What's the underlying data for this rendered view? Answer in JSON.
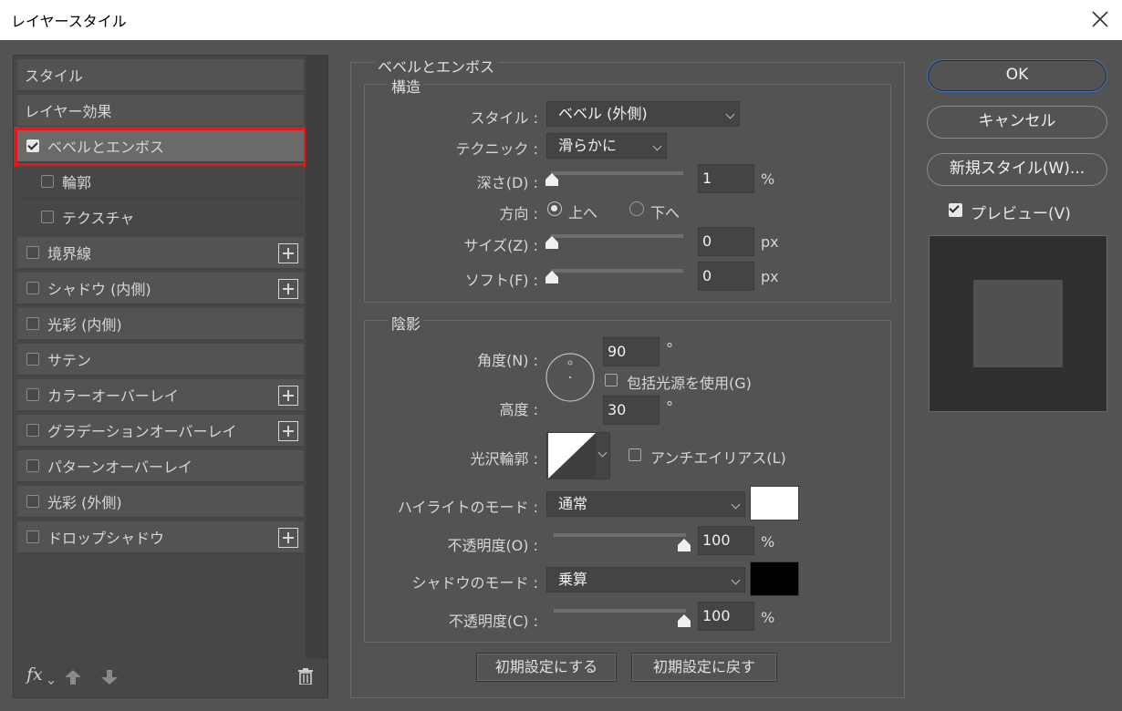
{
  "window": {
    "title": "レイヤースタイル"
  },
  "left_panel": {
    "items": [
      {
        "label": "スタイル"
      },
      {
        "label": "レイヤー効果"
      },
      {
        "label": "ベベルとエンボス"
      },
      {
        "label": "輪郭"
      },
      {
        "label": "テクスチャ"
      },
      {
        "label": "境界線"
      },
      {
        "label": "シャドウ (内側)"
      },
      {
        "label": "光彩 (内側)"
      },
      {
        "label": "サテン"
      },
      {
        "label": "カラーオーバーレイ"
      },
      {
        "label": "グラデーションオーバーレイ"
      },
      {
        "label": "パターンオーバーレイ"
      },
      {
        "label": "光彩 (外側)"
      },
      {
        "label": "ドロップシャドウ"
      }
    ],
    "fx_label": "fx"
  },
  "bevel": {
    "section_title": "ベベルとエンボス",
    "structure_title": "構造",
    "style_label": "スタイル :",
    "style_value": "ベベル (外側)",
    "technique_label": "テクニック :",
    "technique_value": "滑らかに",
    "depth_label": "深さ(D) :",
    "depth_value": "1",
    "depth_unit": "%",
    "direction_label": "方向 :",
    "direction_up": "上へ",
    "direction_down": "下へ",
    "size_label": "サイズ(Z) :",
    "size_value": "0",
    "size_unit": "px",
    "soften_label": "ソフト(F) :",
    "soften_value": "0",
    "soften_unit": "px"
  },
  "shading": {
    "title": "陰影",
    "angle_label": "角度(N) :",
    "angle_value": "90",
    "angle_unit": "°",
    "global_light_label": "包括光源を使用(G)",
    "altitude_label": "高度 :",
    "altitude_value": "30",
    "altitude_unit": "°",
    "gloss_label": "光沢輪郭 :",
    "antialias_label": "アンチエイリアス(L)",
    "highlight_mode_label": "ハイライトのモード :",
    "highlight_mode_value": "通常",
    "highlight_color": "#ffffff",
    "highlight_opacity_label": "不透明度(O) :",
    "highlight_opacity_value": "100",
    "highlight_opacity_unit": "%",
    "shadow_mode_label": "シャドウのモード :",
    "shadow_mode_value": "乗算",
    "shadow_color": "#000000",
    "shadow_opacity_label": "不透明度(C) :",
    "shadow_opacity_value": "100",
    "shadow_opacity_unit": "%"
  },
  "footer_buttons": {
    "make_default": "初期設定にする",
    "reset_default": "初期設定に戻す"
  },
  "right": {
    "ok": "OK",
    "cancel": "キャンセル",
    "new_style": "新規スタイル(W)...",
    "preview_label": "プレビュー(V)"
  },
  "colors": {
    "selection_outline": "#e01a1a",
    "ok_border": "#3a72c8"
  }
}
